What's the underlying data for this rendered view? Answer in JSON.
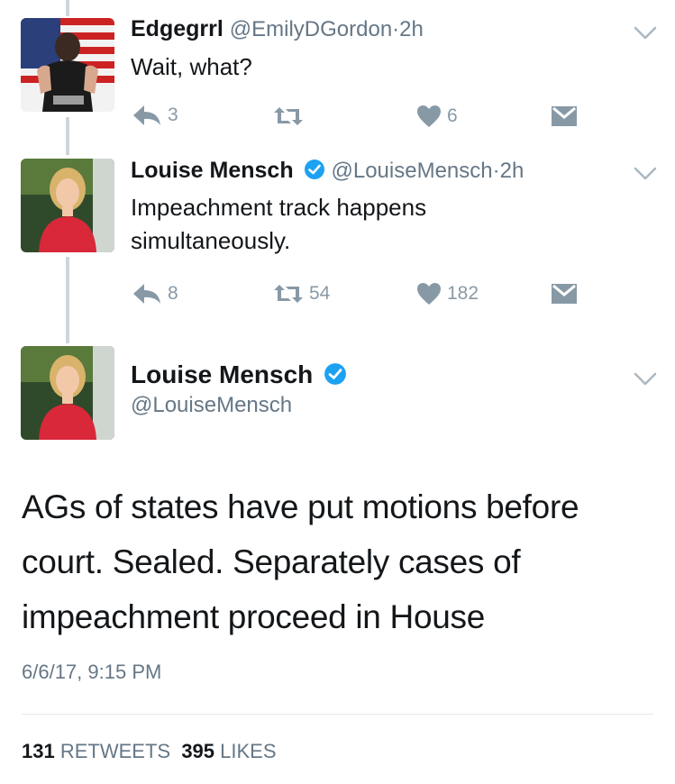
{
  "tweet1": {
    "name": "Edgegrrl",
    "handle": "@EmilyDGordon",
    "time": "2h",
    "text": "Wait, what?",
    "replies": "3",
    "retweets": "",
    "likes": "6"
  },
  "tweet2": {
    "name": "Louise Mensch",
    "handle": "@LouiseMensch",
    "time": "2h",
    "text_line1": "Impeachment track happens",
    "text_line2": "simultaneously.",
    "replies": "8",
    "retweets": "54",
    "likes": "182"
  },
  "main": {
    "name": "Louise Mensch",
    "handle": "@LouiseMensch",
    "line1": "AGs of states have put motions before",
    "line2": "court. Sealed. Separately cases of",
    "line3": "impeachment proceed in House",
    "timestamp": "6/6/17, 9:15 PM",
    "retweet_count": "131",
    "retweet_label": "RETWEETS",
    "like_count": "395",
    "like_label": "LIKES"
  },
  "colors": {
    "icon_gray": "#8899a6",
    "meta_gray": "#657786",
    "verified_blue": "#1da1f2",
    "thread_line": "#ccd6dd"
  },
  "icons": [
    "reply-icon",
    "retweet-icon",
    "like-icon",
    "dm-icon",
    "chevron-down-icon",
    "verified-badge-icon"
  ]
}
